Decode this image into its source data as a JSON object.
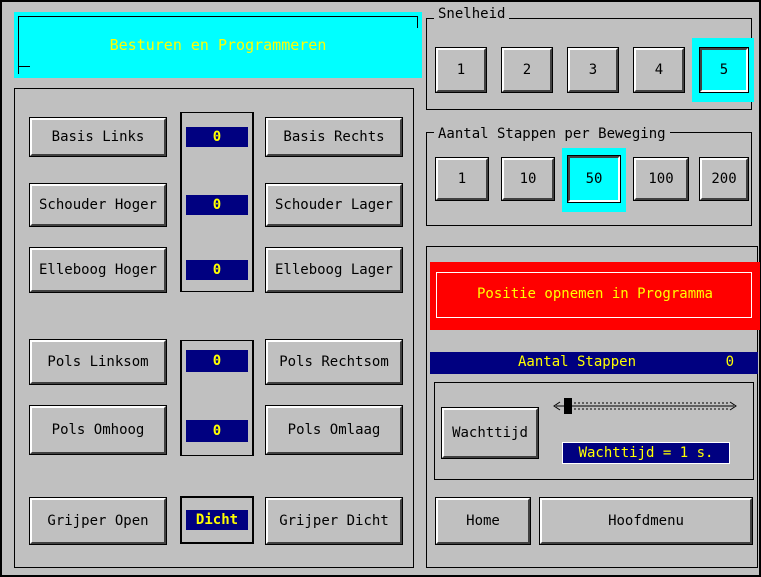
{
  "title": "Besturen en Programmeren",
  "joints": [
    {
      "left": "Basis Links",
      "right": "Basis Rechts",
      "value": "0"
    },
    {
      "left": "Schouder Hoger",
      "right": "Schouder Lager",
      "value": "0"
    },
    {
      "left": "Elleboog Hoger",
      "right": "Elleboog Lager",
      "value": "0"
    },
    {
      "left": "Pols Linksom",
      "right": "Pols Rechtsom",
      "value": "0"
    },
    {
      "left": "Pols Omhoog",
      "right": "Pols Omlaag",
      "value": "0"
    }
  ],
  "gripper": {
    "left": "Grijper Open",
    "state": "Dicht",
    "right": "Grijper Dicht"
  },
  "speed": {
    "legend": "Snelheid",
    "options": [
      "1",
      "2",
      "3",
      "4",
      "5"
    ],
    "selected": "5"
  },
  "steps": {
    "legend": "Aantal Stappen per Beweging",
    "options": [
      "1",
      "10",
      "50",
      "100",
      "200"
    ],
    "selected": "50"
  },
  "program": {
    "record_label": "Positie opnemen in Programma",
    "count_label": "Aantal Stappen",
    "count_value": "0",
    "wait_button": "Wachttijd",
    "wait_display": "Wachttijd = 1 s.",
    "wait_slider_level": 0.0
  },
  "nav": {
    "home": "Home",
    "menu": "Hoofdmenu"
  },
  "colors": {
    "face": "#c0c0c0",
    "selected": "#00ffff",
    "value_bg": "#000080",
    "value_fg": "#ffff00",
    "record_bg": "#ff0000"
  }
}
